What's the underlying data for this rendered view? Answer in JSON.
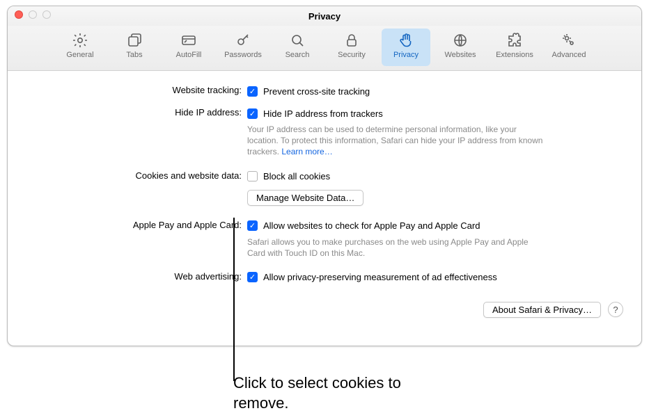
{
  "window": {
    "title": "Privacy"
  },
  "tabs": [
    {
      "label": "General",
      "name": "tab-general",
      "selected": false
    },
    {
      "label": "Tabs",
      "name": "tab-tabs",
      "selected": false
    },
    {
      "label": "AutoFill",
      "name": "tab-autofill",
      "selected": false
    },
    {
      "label": "Passwords",
      "name": "tab-passwords",
      "selected": false
    },
    {
      "label": "Search",
      "name": "tab-search",
      "selected": false
    },
    {
      "label": "Security",
      "name": "tab-security",
      "selected": false
    },
    {
      "label": "Privacy",
      "name": "tab-privacy",
      "selected": true
    },
    {
      "label": "Websites",
      "name": "tab-websites",
      "selected": false
    },
    {
      "label": "Extensions",
      "name": "tab-extensions",
      "selected": false
    },
    {
      "label": "Advanced",
      "name": "tab-advanced",
      "selected": false
    }
  ],
  "tracking": {
    "label": "Website tracking:",
    "checkbox": "Prevent cross-site tracking",
    "checked": true
  },
  "hideip": {
    "label": "Hide IP address:",
    "checkbox": "Hide IP address from trackers",
    "checked": true,
    "helper": "Your IP address can be used to determine personal information, like your location. To protect this information, Safari can hide your IP address from known trackers. ",
    "learn": "Learn more…"
  },
  "cookies": {
    "label": "Cookies and website data:",
    "checkbox": "Block all cookies",
    "checked": false,
    "button": "Manage Website Data…"
  },
  "applepay": {
    "label": "Apple Pay and Apple Card:",
    "checkbox": "Allow websites to check for Apple Pay and Apple Card",
    "checked": true,
    "helper": "Safari allows you to make purchases on the web using Apple Pay and Apple Card with Touch ID on this Mac."
  },
  "webad": {
    "label": "Web advertising:",
    "checkbox": "Allow privacy-preserving measurement of ad effectiveness",
    "checked": true
  },
  "footer": {
    "about": "About Safari & Privacy…",
    "help": "?"
  },
  "callout": "Click to select cookies to remove."
}
